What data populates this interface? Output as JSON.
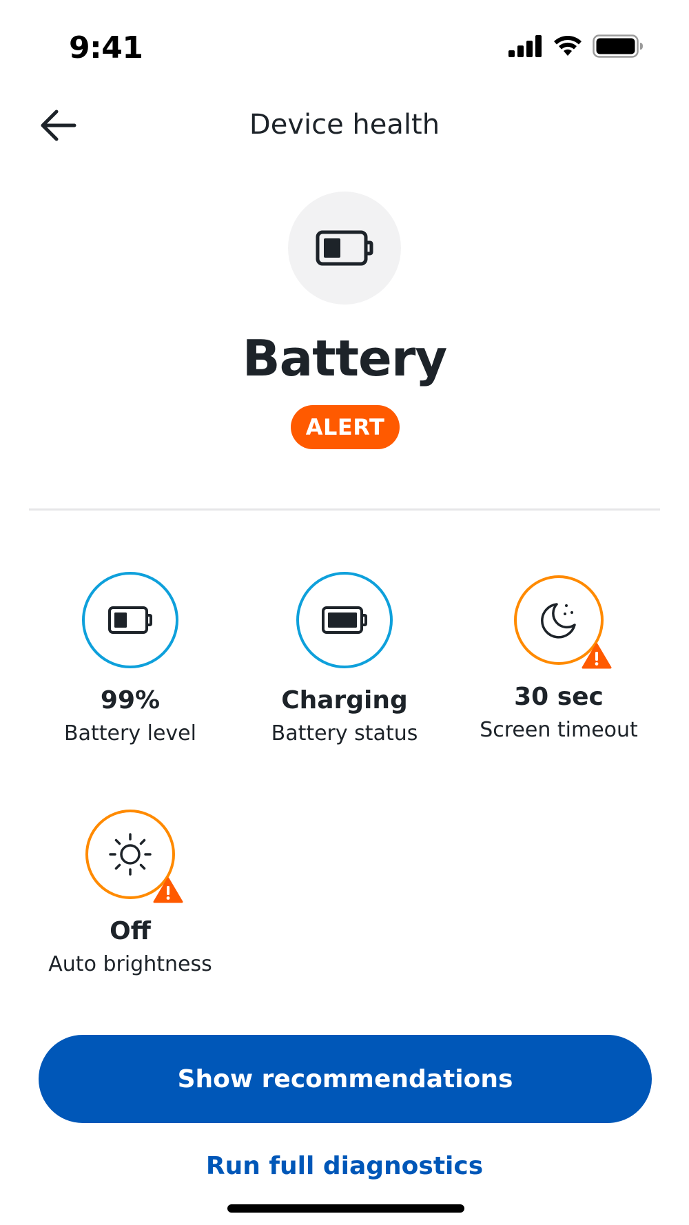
{
  "status_bar": {
    "time": "9:41",
    "icons": [
      "signal-icon",
      "wifi-icon",
      "battery-icon"
    ]
  },
  "nav": {
    "back_icon": "arrow-left-icon",
    "title": "Device health"
  },
  "hero": {
    "icon": "battery-half-icon",
    "title": "Battery",
    "badge": "ALERT",
    "badge_color": "#ff5a00"
  },
  "metrics": [
    {
      "value": "99%",
      "label": "Battery level",
      "icon": "battery-half-icon",
      "status": "ok",
      "ring_color": "#0ea0db"
    },
    {
      "value": "Charging",
      "label": "Battery status",
      "icon": "battery-full-icon",
      "status": "ok",
      "ring_color": "#0ea0db"
    },
    {
      "value": "30 sec",
      "label": "Screen timeout",
      "icon": "moon-icon",
      "status": "warning",
      "ring_color": "#ff8a00"
    },
    {
      "value": "Off",
      "label": "Auto brightness",
      "icon": "sun-icon",
      "status": "warning",
      "ring_color": "#ff8a00"
    }
  ],
  "actions": {
    "primary": "Show recommendations",
    "secondary": "Run full diagnostics"
  },
  "colors": {
    "primary": "#0057b8",
    "ok": "#0ea0db",
    "warning": "#ff8a00",
    "alert": "#ff5a00"
  }
}
